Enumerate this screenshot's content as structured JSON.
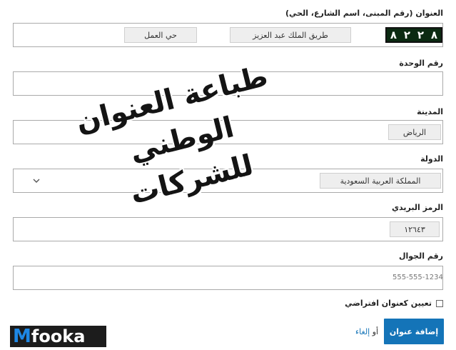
{
  "address": {
    "label": "العنوان (رقم المبنى، اسم الشارع، الحي)",
    "building_digits": [
      "٨",
      "٢",
      "٢",
      "٨"
    ],
    "street": "طريق الملك عبد العزيز",
    "district": "حي العمل"
  },
  "unit": {
    "label": "رقم الوحدة",
    "value": ""
  },
  "city": {
    "label": "المدينة",
    "value": "الرياض"
  },
  "country": {
    "label": "الدولة",
    "value": "المملكة العربية السعودية"
  },
  "postal": {
    "label": "الرمز البريدي",
    "value": "١٢٦٤٣"
  },
  "mobile": {
    "label": "رقم الجوال",
    "placeholder": "555-555-1234"
  },
  "default_checkbox": {
    "label": "تعيين كعنوان افتراضي",
    "checked": false
  },
  "actions": {
    "add_label": "إضافة عنوان",
    "or": "أو",
    "cancel_label": "إلغاء"
  },
  "overlay": {
    "line1": "طباعة العنوان الوطني",
    "line2": "للشركات"
  },
  "logo": {
    "first": "M",
    "rest": "fooka"
  },
  "colors": {
    "primary": "#1474b8",
    "plate_bg": "#0b2a12",
    "logo_m": "#1e88e5"
  }
}
